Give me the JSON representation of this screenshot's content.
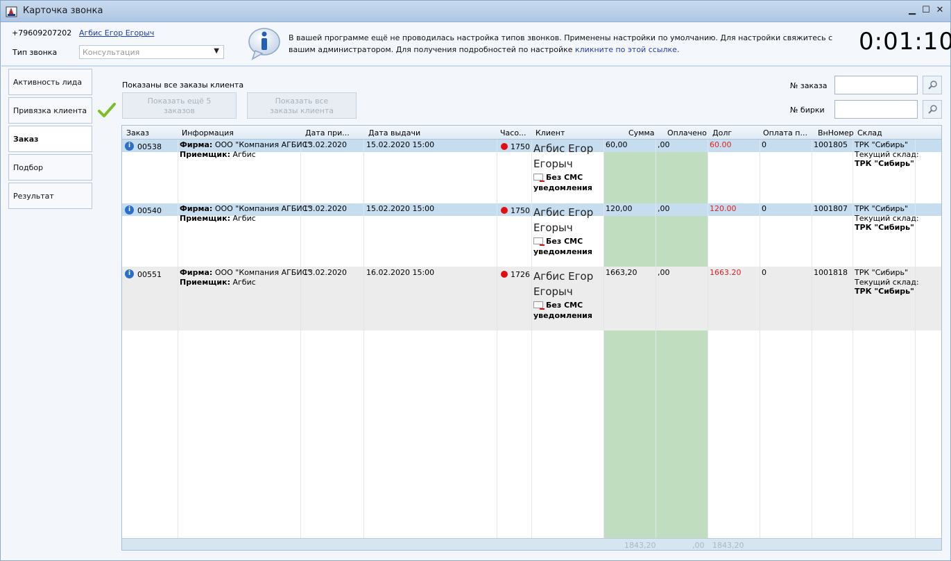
{
  "window": {
    "title": "Карточка звонка",
    "minimize": "▁",
    "maximize": "☐",
    "close": "✕"
  },
  "header": {
    "phone": "+79609207202",
    "client_name": "Агбис Егор Егорыч",
    "call_type_label": "Тип звонка",
    "call_type_value": "Консультация",
    "notice_text": "В вашей программе ещё не проводилась настройка типов звонков. Применены настройки по умолчанию. Для настройки свяжитесь с вашим администратором. Для получения подробностей по настройке ",
    "notice_link": "кликните по этой ссылке.",
    "timer": "0:01:10"
  },
  "sidebar": {
    "items": [
      {
        "label": "Активность лида"
      },
      {
        "label": "Привязка клиента"
      },
      {
        "label": "Заказ"
      },
      {
        "label": "Подбор"
      },
      {
        "label": "Результат"
      }
    ]
  },
  "orders_panel": {
    "shown_label": "Показаны все заказы клиента",
    "show_more_label": "Показать ещё 5 заказов",
    "show_all_label": "Показать все заказы клиента",
    "order_no_label": "№ заказа",
    "tag_no_label": "№ бирки",
    "order_no_value": "",
    "tag_no_value": ""
  },
  "table": {
    "columns": [
      "Заказ",
      "Информация",
      "Дата при...",
      "Дата выдачи",
      "Часо...",
      "Клиент",
      "Сумма",
      "Оплачено",
      "Долг",
      "Оплата п...",
      "ВнНомер",
      "Склад"
    ],
    "rows": [
      {
        "order": "00538",
        "firm_label": "Фирма:",
        "firm": "ООО \"Компания АГБИС\"",
        "receiver_label": "Приемщик:",
        "receiver": "Агбис",
        "date_in": "13.02.2020",
        "date_out": "15.02.2020 15:00",
        "hours": "1750",
        "client_line1": "Агбис Егор",
        "client_line2": "Егорыч",
        "sms1": "Без СМС",
        "sms2": "уведомления",
        "sum": "60,00",
        "paid": ",00",
        "debt": "60.00",
        "pay_p": "0",
        "inner_no": "1001805",
        "store": "ТРК \"Сибирь\"",
        "current_store_label": "Текущий склад:",
        "current_store": "ТРК \"Сибирь\""
      },
      {
        "order": "00540",
        "firm_label": "Фирма:",
        "firm": "ООО \"Компания АГБИС\"",
        "receiver_label": "Приемщик:",
        "receiver": "Агбис",
        "date_in": "13.02.2020",
        "date_out": "15.02.2020 15:00",
        "hours": "1750",
        "client_line1": "Агбис Егор",
        "client_line2": "Егорыч",
        "sms1": "Без СМС",
        "sms2": "уведомления",
        "sum": "120,00",
        "paid": ",00",
        "debt": "120.00",
        "pay_p": "0",
        "inner_no": "1001807",
        "store": "ТРК \"Сибирь\"",
        "current_store_label": "Текущий склад:",
        "current_store": "ТРК \"Сибирь\""
      },
      {
        "order": "00551",
        "firm_label": "Фирма:",
        "firm": "ООО \"Компания АГБИС\"",
        "receiver_label": "Приемщик:",
        "receiver": "Агбис",
        "date_in": "13.02.2020",
        "date_out": "16.02.2020 15:00",
        "hours": "1726",
        "client_line1": "Агбис Егор",
        "client_line2": "Егорыч",
        "sms1": "Без СМС",
        "sms2": "уведомления",
        "sum": "1663,20",
        "paid": ",00",
        "debt": "1663.20",
        "pay_p": "0",
        "inner_no": "1001818",
        "store": "ТРК \"Сибирь\"",
        "current_store_label": "Текущий склад:",
        "current_store": "ТРК \"Сибирь\""
      }
    ],
    "footer": {
      "sum_total": "1843,20",
      "paid_total": ",00",
      "debt_total": "1843,20"
    }
  },
  "colors": {
    "accent": "#1d3db5",
    "row_band": "#c6dcef",
    "green_col": "#c0ddc0",
    "debt_red": "#e02020"
  },
  "icons": {
    "info": "info-bubble-icon",
    "check": "green-check-icon",
    "search": "magnifier-icon",
    "sms": "envelope-no-sms-icon"
  }
}
